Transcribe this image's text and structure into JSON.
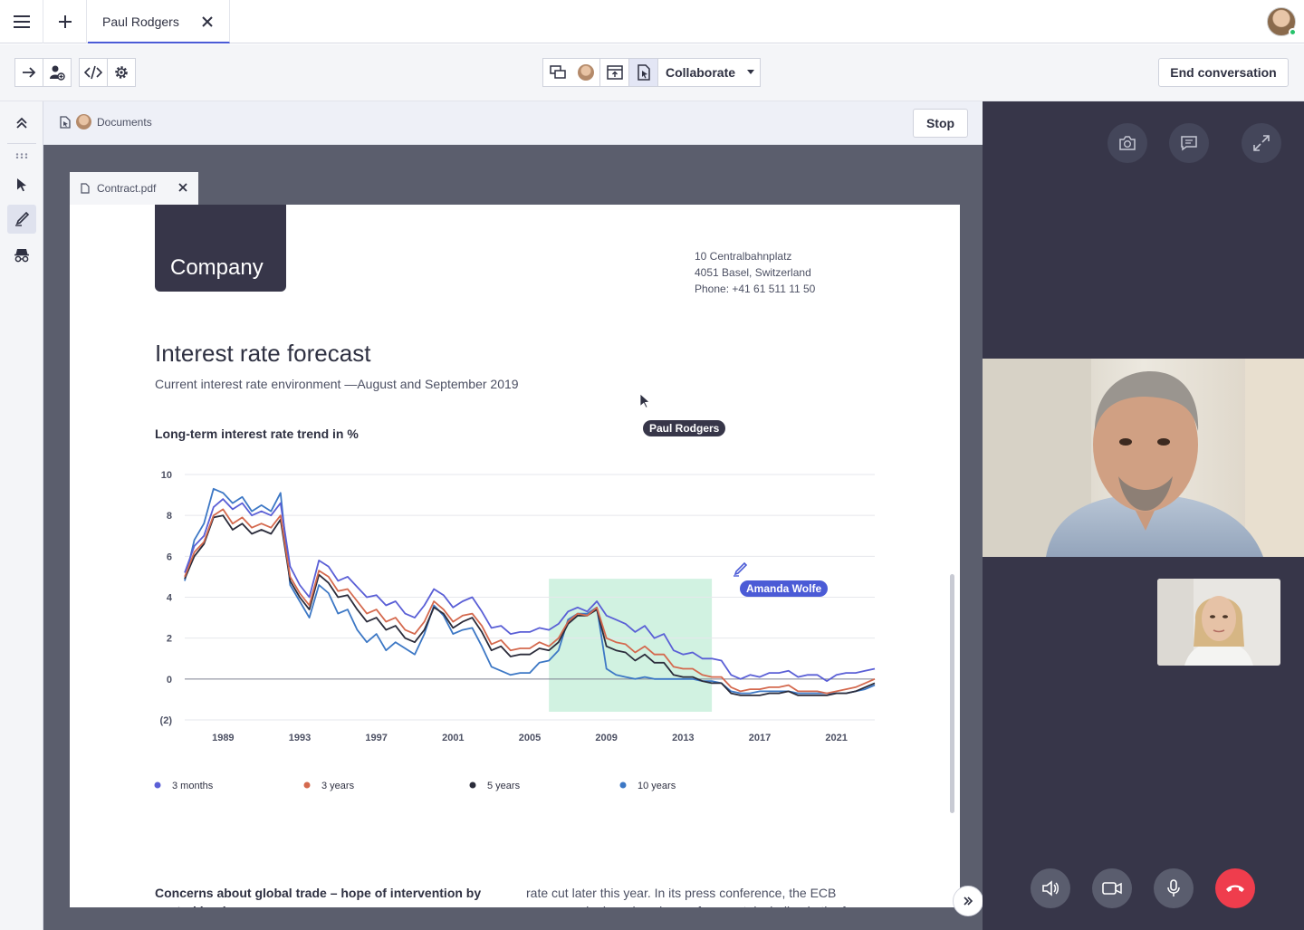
{
  "tab": {
    "label": "Paul Rodgers"
  },
  "toolbar": {
    "collaborate_label": "Collaborate",
    "end_label": "End conversation"
  },
  "documents": {
    "breadcrumb_label": "Documents",
    "stop_label": "Stop",
    "file_tab_label": "Contract.pdf"
  },
  "page": {
    "logo_text": "Company",
    "address_line1": "10 Centralbahnplatz",
    "address_line2": "4051 Basel, Switzerland",
    "address_line3": "Phone: +41 61 511 11 50",
    "title": "Interest rate forecast",
    "subtitle": "Current interest rate environment —August and September 2019",
    "chart_title": "Long-term interest rate trend in %",
    "col1_text": "Concerns about global trade – hope of intervention by central banks",
    "col2_text": "rate cut later this year. In its press conference, the ECB announced a broad package of support, including in the form of"
  },
  "cursors": {
    "paul_label": "Paul Rodgers",
    "amanda_label": "Amanda Wolfe",
    "paul_color": "#373649",
    "amanda_color": "#4b5bd6"
  },
  "chart_data": {
    "type": "line",
    "title": "Long-term interest rate trend in %",
    "x_ticks": [
      "1989",
      "1993",
      "1997",
      "2001",
      "2005",
      "2009",
      "2013",
      "2017",
      "2021"
    ],
    "y_ticks": [
      "10",
      "8",
      "6",
      "4",
      "2",
      "0",
      "(2)"
    ],
    "xlim": [
      1987,
      2023
    ],
    "ylim": [
      -2,
      10
    ],
    "x": [
      1987.0,
      1987.5,
      1988.0,
      1988.5,
      1989.0,
      1989.5,
      1990.0,
      1990.5,
      1991.0,
      1991.5,
      1992.0,
      1992.5,
      1993.0,
      1993.5,
      1994.0,
      1994.5,
      1995.0,
      1995.5,
      1996.0,
      1996.5,
      1997.0,
      1997.5,
      1998.0,
      1998.5,
      1999.0,
      1999.5,
      2000.0,
      2000.5,
      2001.0,
      2001.5,
      2002.0,
      2002.5,
      2003.0,
      2003.5,
      2004.0,
      2004.5,
      2005.0,
      2005.5,
      2006.0,
      2006.5,
      2007.0,
      2007.5,
      2008.0,
      2008.5,
      2009.0,
      2009.5,
      2010.0,
      2010.5,
      2011.0,
      2011.5,
      2012.0,
      2012.5,
      2013.0,
      2013.5,
      2014.0,
      2014.5,
      2015.0,
      2015.5,
      2016.0,
      2016.5,
      2017.0,
      2017.5,
      2018.0,
      2018.5,
      2019.0,
      2019.5,
      2020.0,
      2020.5,
      2021.0,
      2021.5,
      2022.0,
      2022.5,
      2023.0
    ],
    "series": [
      {
        "name": "3 months",
        "color": "#5a5fd6",
        "values": [
          5.2,
          6.5,
          7.0,
          8.4,
          8.8,
          8.3,
          8.6,
          8.0,
          8.2,
          8.0,
          8.6,
          5.5,
          4.6,
          4.0,
          5.8,
          5.5,
          4.8,
          5.0,
          4.5,
          4.0,
          4.1,
          3.6,
          3.8,
          3.2,
          3.0,
          3.6,
          4.4,
          4.1,
          3.5,
          3.8,
          4.0,
          3.3,
          2.5,
          2.6,
          2.2,
          2.3,
          2.3,
          2.5,
          2.4,
          2.7,
          3.3,
          3.5,
          3.3,
          3.8,
          3.1,
          2.9,
          2.7,
          2.3,
          2.6,
          2.0,
          2.2,
          1.4,
          1.2,
          1.3,
          1.0,
          1.0,
          0.9,
          0.2,
          0.0,
          0.2,
          0.1,
          0.3,
          0.3,
          0.4,
          0.1,
          0.2,
          0.2,
          -0.1,
          0.2,
          0.3,
          0.3,
          0.4,
          0.5
        ]
      },
      {
        "name": "3 years",
        "color": "#d4694e",
        "values": [
          5.0,
          6.2,
          6.7,
          8.0,
          8.3,
          7.6,
          7.9,
          7.4,
          7.6,
          7.4,
          8.0,
          5.0,
          4.2,
          3.6,
          5.3,
          5.0,
          4.3,
          4.4,
          3.8,
          3.2,
          3.4,
          2.8,
          3.0,
          2.4,
          2.2,
          2.8,
          3.8,
          3.4,
          2.8,
          3.1,
          3.2,
          2.6,
          1.7,
          1.9,
          1.4,
          1.5,
          1.5,
          1.8,
          1.6,
          2.0,
          2.8,
          3.2,
          3.1,
          3.5,
          2.0,
          1.8,
          1.7,
          1.3,
          1.6,
          1.2,
          1.2,
          0.6,
          0.5,
          0.5,
          0.2,
          0.1,
          0.1,
          -0.4,
          -0.6,
          -0.5,
          -0.5,
          -0.4,
          -0.4,
          -0.3,
          -0.6,
          -0.6,
          -0.6,
          -0.7,
          -0.6,
          -0.5,
          -0.4,
          -0.2,
          0.0
        ]
      },
      {
        "name": "5 years",
        "color": "#2b2c3b",
        "values": [
          4.9,
          6.0,
          6.6,
          7.9,
          8.0,
          7.3,
          7.6,
          7.1,
          7.3,
          7.1,
          7.8,
          4.8,
          4.0,
          3.4,
          5.1,
          4.7,
          4.0,
          4.1,
          3.4,
          2.8,
          3.0,
          2.4,
          2.6,
          2.0,
          1.8,
          2.4,
          3.5,
          3.2,
          2.5,
          2.8,
          3.0,
          2.3,
          1.4,
          1.6,
          1.1,
          1.2,
          1.2,
          1.5,
          1.4,
          1.8,
          2.7,
          3.1,
          3.1,
          3.4,
          1.6,
          1.4,
          1.3,
          0.9,
          1.2,
          0.8,
          0.8,
          0.2,
          0.1,
          0.1,
          -0.1,
          -0.2,
          -0.2,
          -0.7,
          -0.8,
          -0.8,
          -0.8,
          -0.7,
          -0.7,
          -0.6,
          -0.8,
          -0.8,
          -0.8,
          -0.8,
          -0.7,
          -0.7,
          -0.6,
          -0.4,
          -0.2
        ]
      },
      {
        "name": "10 years",
        "color": "#3d78c5",
        "values": [
          4.8,
          6.8,
          7.6,
          9.3,
          9.1,
          8.6,
          8.9,
          8.2,
          8.5,
          8.2,
          9.1,
          4.6,
          3.8,
          3.0,
          4.6,
          4.2,
          3.2,
          3.4,
          2.4,
          1.8,
          2.2,
          1.4,
          1.8,
          1.5,
          1.2,
          2.2,
          3.6,
          3.1,
          2.2,
          2.4,
          2.5,
          1.6,
          0.6,
          0.4,
          0.2,
          0.3,
          0.3,
          0.8,
          0.9,
          1.4,
          2.9,
          3.2,
          3.2,
          3.5,
          0.5,
          0.2,
          0.1,
          0.0,
          0.1,
          0.0,
          0.0,
          0.0,
          0.0,
          0.0,
          -0.1,
          -0.1,
          -0.2,
          -0.6,
          -0.7,
          -0.7,
          -0.6,
          -0.6,
          -0.6,
          -0.6,
          -0.7,
          -0.7,
          -0.7,
          -0.7,
          -0.7,
          -0.7,
          -0.6,
          -0.5,
          -0.3
        ]
      }
    ],
    "highlight_range": [
      2006.0,
      2014.5
    ],
    "grid": true,
    "legend_placement": "bottom"
  }
}
